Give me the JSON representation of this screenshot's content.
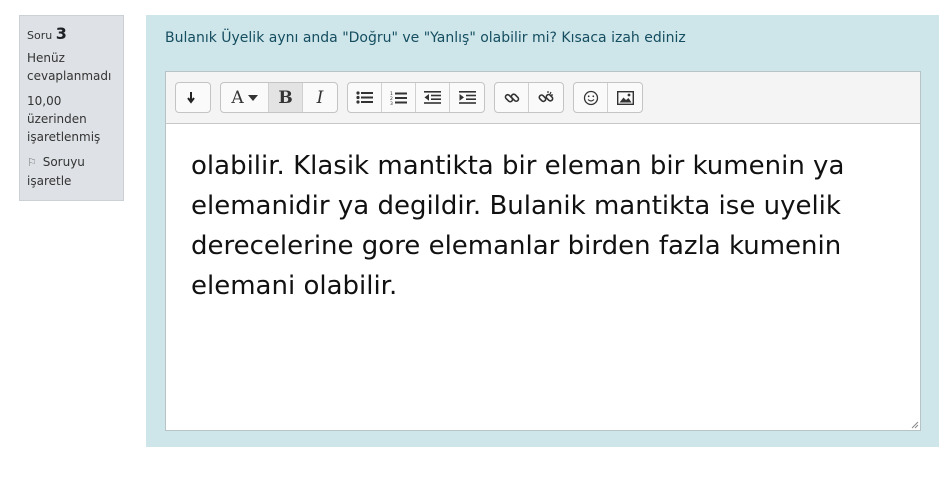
{
  "info": {
    "question_label": "Soru",
    "question_number": "3",
    "state": "Henüz cevaplanmadı",
    "grade": "10,00 üzerinden işaretlenmiş",
    "flag_label": "Soruyu işaretle"
  },
  "question": {
    "text": "Bulanık Üyelik aynı anda \"Doğru\" ve \"Yanlış\" olabilir mi? Kısaca izah ediniz"
  },
  "toolbar": {
    "font_letter": "A",
    "bold_letter": "B",
    "italic_letter": "I",
    "buttons": [
      "collapse",
      "font-color",
      "bold",
      "italic",
      "unordered-list",
      "ordered-list",
      "outdent",
      "indent",
      "link",
      "unlink",
      "emoji",
      "image"
    ]
  },
  "answer": {
    "text": "olabilir. Klasik mantikta bir eleman bir kumenin ya elemanidir ya degildir. Bulanik mantikta ise uyelik derecelerine gore elemanlar birden fazla kumenin elemani olabilir."
  },
  "colors": {
    "content_bg": "#cee6ea",
    "info_bg": "#dee2e6",
    "question_text": "#154e60"
  }
}
